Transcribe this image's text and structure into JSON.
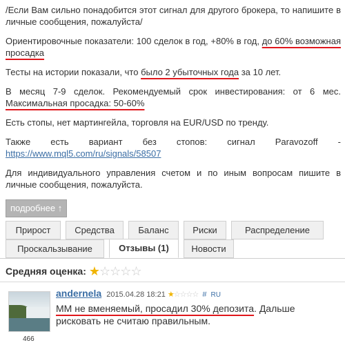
{
  "description": {
    "p1": "/Если Вам сильно понадобится этот сигнал для другого брокера, то напишите в личные сообщения, пожалуйста/",
    "p2_a": "Ориентировочные показатели: 100 сделок в год, +80% в год, ",
    "p2_b": "до 60% возможная просадка",
    "p3_a": "Тесты на истории показали, что ",
    "p3_b": "было 2 убыточных года",
    "p3_c": " за 10 лет.",
    "p4_a": "В месяц 7-9 сделок. Рекомендуемый срок инвестирования: от 6 мес. ",
    "p4_b": "Максимальная просадка: 50-60%",
    "p5": "Есть стопы, нет мартингейла, торговля на EUR/USD по тренду.",
    "p6_a": "Также есть вариант без стопов: сигнал Paravozoff - ",
    "p6_link": "https://www.mql5.com/ru/signals/58507",
    "p7": "Для индивидуального управления счетом и по иным вопросам пишите в личные сообщения, пожалуйста."
  },
  "more_button": "подробнее ↑",
  "tabs": [
    {
      "label": "Прирост"
    },
    {
      "label": "Средства"
    },
    {
      "label": "Баланс"
    },
    {
      "label": "Риски"
    },
    {
      "label": "Распределение"
    },
    {
      "label": "Проскальзывание"
    },
    {
      "label": "Отзывы (1)",
      "active": true
    },
    {
      "label": "Новости"
    }
  ],
  "rating": {
    "label": "Средняя оценка:",
    "value": 1,
    "max": 5
  },
  "review": {
    "author": "andernela",
    "date": "2015.04.28 18:21",
    "stars": 1,
    "hash": "#",
    "lang": "RU",
    "avatar_count": "466",
    "text_a": "ММ не вменяемый, просадил 30% депозита",
    "text_b": ". Дальше рисковать не считаю правильным."
  },
  "colors": {
    "underline": "#e0161b",
    "link": "#3b6ea5",
    "star": "#f0b400"
  }
}
